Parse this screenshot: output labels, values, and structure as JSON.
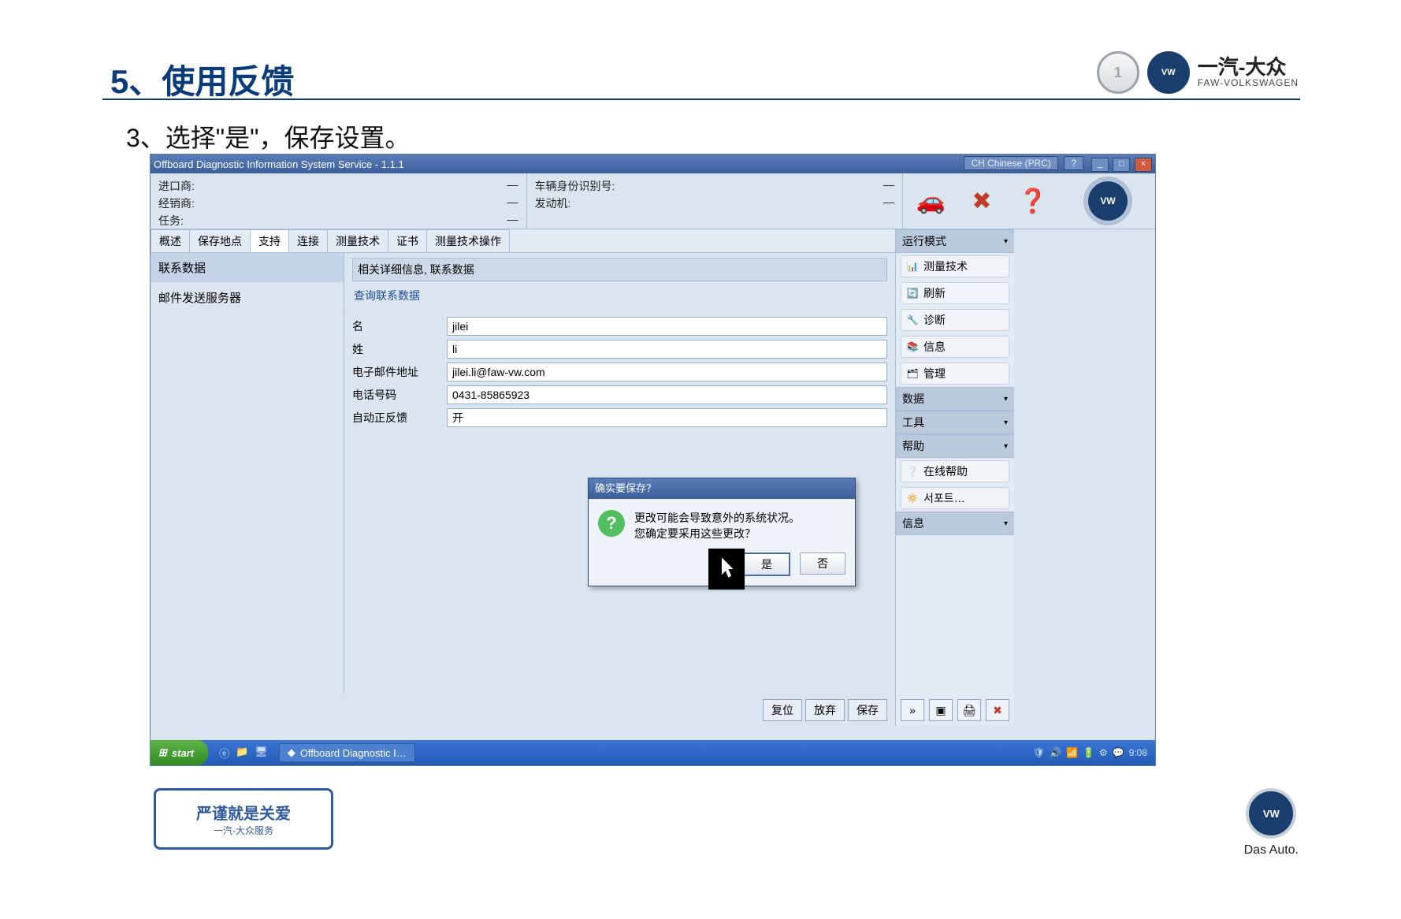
{
  "slide": {
    "title": "5、使用反馈",
    "step": "3、选择\"是\"，保存设置。"
  },
  "brand": {
    "cn": "一汽-大众",
    "en": "FAW-VOLKSWAGEN",
    "vw_glyph": "VW",
    "faw_glyph": "1"
  },
  "app": {
    "titlebar": "Offboard Diagnostic Information System Service - 1.1.1",
    "lang_btn": "CH Chinese (PRC)",
    "help_glyph": "?",
    "win_min": "_",
    "win_max": "□",
    "win_close": "×",
    "vehicle_info": {
      "left": [
        {
          "label": "进口商:",
          "value": "—"
        },
        {
          "label": "经销商:",
          "value": "—"
        },
        {
          "label": "任务:",
          "value": "—"
        }
      ],
      "right": [
        {
          "label": "车辆身份识别号:",
          "value": "—"
        },
        {
          "label": "发动机:",
          "value": "—"
        }
      ]
    },
    "status_icons": {
      "car": "🚗",
      "cross": "✖",
      "question": "❓"
    },
    "tabs": [
      "概述",
      "保存地点",
      "支持",
      "连接",
      "测量技术",
      "证书",
      "测量技术操作"
    ],
    "active_tab_index": 2,
    "left_nav": [
      {
        "label": "联系数据",
        "selected": true
      },
      {
        "label": "邮件发送服务器",
        "selected": false
      }
    ],
    "form": {
      "header": "相关详细信息, 联系数据",
      "link": "查询联系数据",
      "fields": [
        {
          "label": "名",
          "value": "jilei"
        },
        {
          "label": "姓",
          "value": "li"
        },
        {
          "label": "电子邮件地址",
          "value": "jilei.li@faw-vw.com"
        },
        {
          "label": "电话号码",
          "value": "0431-85865923"
        },
        {
          "label": "自动正反馈",
          "value": "开"
        }
      ]
    },
    "bottom_buttons": [
      "复位",
      "放弃",
      "保存"
    ],
    "right_panel": {
      "sections": [
        {
          "title": "运行模式",
          "items": [
            {
              "icon": "📊",
              "label": "测量技术"
            },
            {
              "icon": "🔄",
              "label": "刷新"
            },
            {
              "icon": "🔧",
              "label": "诊断"
            },
            {
              "icon": "📚",
              "label": "信息"
            },
            {
              "icon": "🗂",
              "label": "管理"
            }
          ]
        },
        {
          "title": "数据",
          "items": []
        },
        {
          "title": "工具",
          "items": []
        },
        {
          "title": "帮助",
          "items": [
            {
              "icon": "❔",
              "label": "在线帮助"
            },
            {
              "icon": "🔅",
              "label": "서포트…"
            }
          ]
        },
        {
          "title": "信息",
          "items": []
        }
      ],
      "icon_bar": [
        "»",
        "▣",
        "🖨",
        "✖"
      ]
    },
    "modal": {
      "title": "确实要保存？",
      "line1": "更改可能会导致意外的系统状况。",
      "line2": "您确定要采用这些更改？",
      "yes": "是",
      "no": "否"
    },
    "taskbar": {
      "start": "start",
      "task_label": "Offboard Diagnostic I…",
      "clock": "9:08"
    }
  },
  "footer": {
    "badge_line1": "严谨就是关爱",
    "badge_line2": "一汽-大众服务",
    "das_auto": "Das Auto."
  }
}
